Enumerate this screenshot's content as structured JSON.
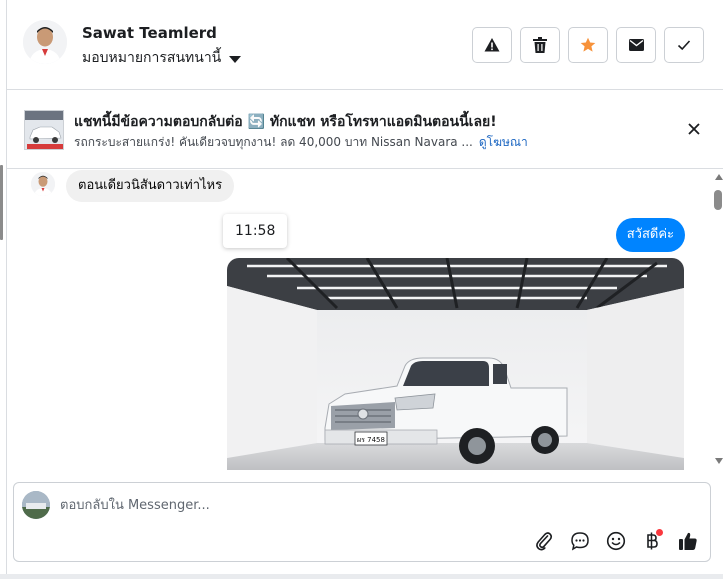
{
  "header": {
    "contact_name": "Sawat Teamlerd",
    "assign_label": "มอบหมายการสนทนานี้",
    "actions": [
      {
        "name": "report-spam-button",
        "icon": "warning-icon"
      },
      {
        "name": "delete-button",
        "icon": "trash-icon"
      },
      {
        "name": "star-button",
        "icon": "star-icon"
      },
      {
        "name": "mark-unread-button",
        "icon": "envelope-icon"
      },
      {
        "name": "mark-done-button",
        "icon": "check-icon"
      }
    ]
  },
  "banner": {
    "title": "แชทนี้มีข้อความตอบกลับต่อ 🔄 ทักแชท หรือโทรหาแอดมินตอนนี้เลย!",
    "subtitle": "รถกระบะสายแกร่ง! คันเดียวจบทุกงาน! ลด 40,000 บาท Nissan Navara ...",
    "link_label": "ดูโฆษณา"
  },
  "chat": {
    "incoming_message": "ตอนเดียวนิสันดาวเท่าไหร",
    "timestamp": "11:58",
    "outgoing_message": "สวัสดีค่ะ",
    "photo_plate": "ผร 7458"
  },
  "composer": {
    "placeholder": "ตอบกลับใน Messenger...",
    "value": ""
  },
  "colors": {
    "accent": "#0084ff",
    "star": "#f7923a",
    "link": "#1d67c2",
    "badge": "#fa383e"
  }
}
